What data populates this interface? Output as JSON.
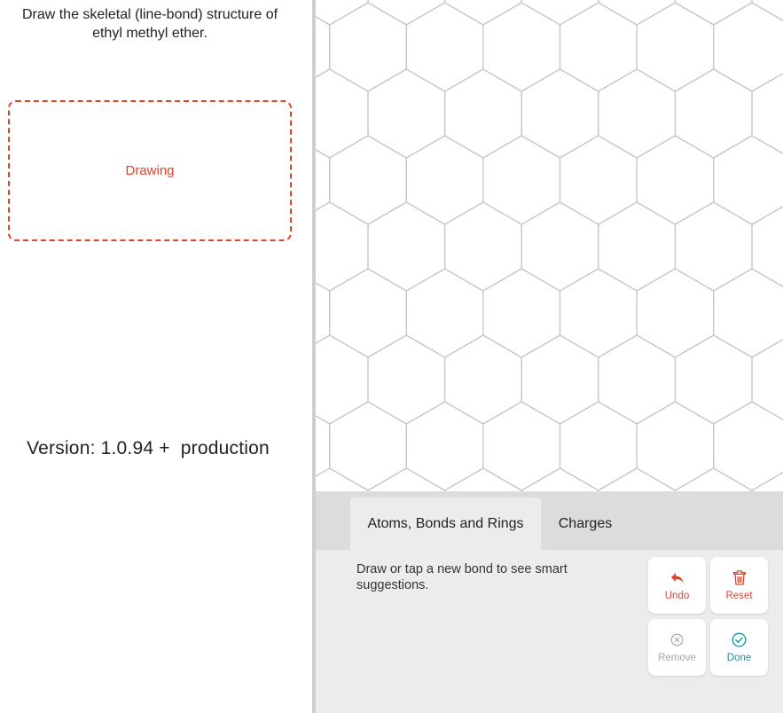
{
  "question": {
    "text": "Draw the skeletal (line-bond) structure of ethyl methyl ether."
  },
  "drawing_box": {
    "label": "Drawing"
  },
  "version": {
    "text": "Version: 1.0.94 +  production"
  },
  "tabs": [
    {
      "label": "Atoms, Bonds and Rings",
      "active": true
    },
    {
      "label": "Charges",
      "active": false
    }
  ],
  "hint": {
    "text": "Draw or tap a new bond to see smart suggestions."
  },
  "tools": {
    "undo": {
      "label": "Undo",
      "icon": "undo-arrow-icon",
      "enabled": true
    },
    "reset": {
      "label": "Reset",
      "icon": "trash-icon",
      "enabled": true
    },
    "remove": {
      "label": "Remove",
      "icon": "circle-x-icon",
      "enabled": false
    },
    "done": {
      "label": "Done",
      "icon": "circle-check-icon",
      "enabled": true
    }
  },
  "colors": {
    "accent_red": "#e0442b",
    "done_teal": "#16939e",
    "disabled_gray": "#a5a5a5",
    "grid_line": "#c4c4c4",
    "tab_bar": "#dcdcdc",
    "tool_area": "#ececec"
  }
}
